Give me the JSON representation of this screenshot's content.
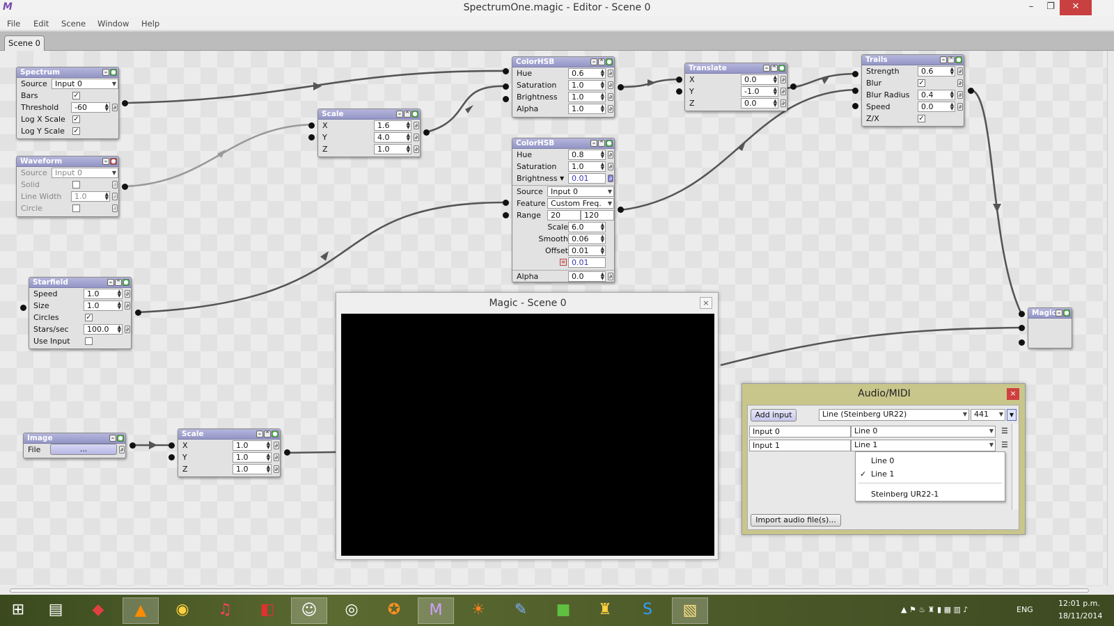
{
  "window": {
    "title": "SpectrumOne.magic - Editor - Scene 0",
    "logo": "M",
    "minimize": "–",
    "restore": "❐",
    "close": "✕"
  },
  "menu": [
    "File",
    "Edit",
    "Scene",
    "Window",
    "Help"
  ],
  "tab": "Scene 0",
  "nodes": {
    "spectrum": {
      "title": "Spectrum",
      "source_label": "Source",
      "source": "Input 0",
      "bars": "Bars",
      "threshold_label": "Threshold",
      "threshold": "-60",
      "logx": "Log X Scale",
      "logy": "Log Y Scale"
    },
    "waveform": {
      "title": "Waveform",
      "source_label": "Source",
      "source": "Input 0",
      "solid": "Solid",
      "linewidth_label": "Line Width",
      "linewidth": "1.0",
      "circle": "Circle"
    },
    "starfield": {
      "title": "Starfield",
      "speed_label": "Speed",
      "speed": "1.0",
      "size_label": "Size",
      "size": "1.0",
      "circles": "Circles",
      "stars_label": "Stars/sec",
      "stars": "100.0",
      "useinput": "Use Input"
    },
    "image": {
      "title": "Image",
      "file_label": "File",
      "file": "..."
    },
    "scale1": {
      "title": "Scale",
      "x": "1.6",
      "y": "4.0",
      "z": "1.0"
    },
    "scale2": {
      "title": "Scale",
      "x": "1.0",
      "y": "1.0",
      "z": "1.0"
    },
    "colorhsb1": {
      "title": "ColorHSB",
      "hue": "0.6",
      "saturation": "1.0",
      "brightness": "1.0",
      "alpha": "1.0"
    },
    "colorhsb2": {
      "title": "ColorHSB",
      "hue": "0.8",
      "saturation": "1.0",
      "brightness": "0.01",
      "source": "Input 0",
      "feature": "Custom Freq.",
      "range_min": "20",
      "range_max": "120",
      "scale": "6.0",
      "smooth": "0.06",
      "offset": "0.01",
      "result": "0.01",
      "alpha": "0.0"
    },
    "translate": {
      "title": "Translate",
      "x": "0.0",
      "y": "-1.0",
      "z": "0.0"
    },
    "trails": {
      "title": "Trails",
      "strength": "0.6",
      "blur_radius": "0.4",
      "speed": "0.0"
    },
    "magic": {
      "title": "Magic"
    }
  },
  "labels": {
    "hue": "Hue",
    "saturation": "Saturation",
    "brightness": "Brightness",
    "alpha": "Alpha",
    "x": "X",
    "y": "Y",
    "z": "Z",
    "source": "Source",
    "feature": "Feature",
    "range": "Range",
    "scale": "Scale",
    "smooth": "Smooth",
    "offset": "Offset",
    "strength": "Strength",
    "blur": "Blur",
    "blur_radius": "Blur Radius",
    "speed": "Speed",
    "zx": "Z/X"
  },
  "glyphs": {
    "check": "✓",
    "close": "×",
    "arrow_down": "▼",
    "spin": "▲▼",
    "link": "∂"
  },
  "preview": {
    "title": "Magic - Scene 0"
  },
  "audio": {
    "title": "Audio/MIDI",
    "add_input": "Add input",
    "device": "Line (Steinberg UR22)",
    "rate": "441",
    "inputs": [
      {
        "name": "Input 0",
        "line": "Line 0"
      },
      {
        "name": "Input 1",
        "line": "Line 1"
      }
    ],
    "menu_options": [
      "Line 0",
      "Line 1",
      "Steinberg UR22-1"
    ],
    "import": "Import audio file(s)..."
  },
  "tray": {
    "lang": "ENG",
    "time": "12:01 p.m.",
    "date": "18/11/2014"
  },
  "taskbar": [
    "start-icon",
    "file-explorer-icon",
    "git-icon",
    "vlc-icon",
    "chrome-icon",
    "itunes-icon",
    "sketchup-icon",
    "gimp-icon",
    "media-icon",
    "blender-icon",
    "magic-icon",
    "sed-icon",
    "editor-icon",
    "minecraft-icon",
    "app-icon",
    "skype-icon",
    "explorer-icon"
  ],
  "colors": {
    "node_header": "#9395c6",
    "audio_bg": "#c9c68c",
    "wire": "#555555"
  }
}
